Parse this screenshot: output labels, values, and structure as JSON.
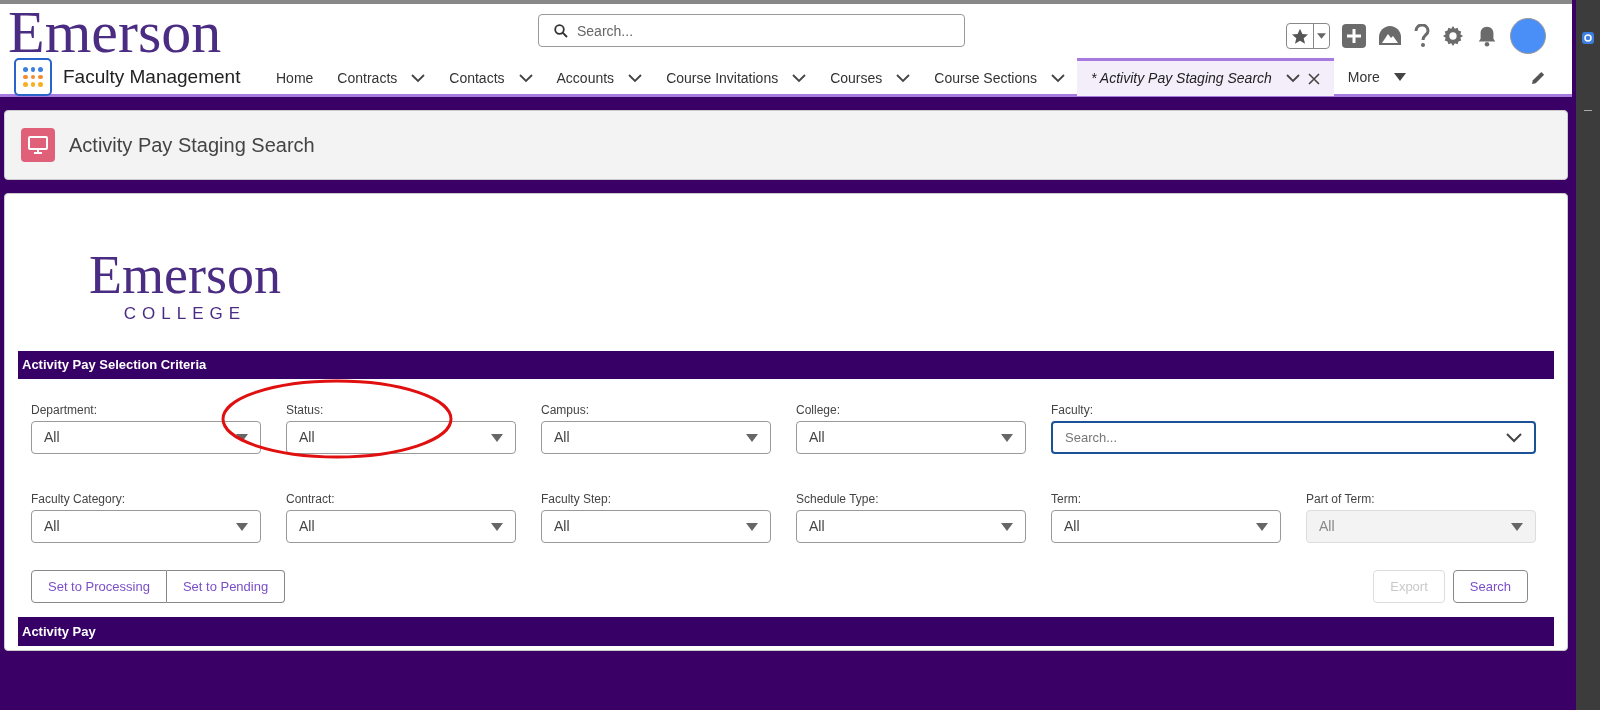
{
  "header": {
    "logo": "Emerson",
    "search": {
      "placeholder": "Search..."
    }
  },
  "nav": {
    "app_name": "Faculty Management",
    "tabs": [
      {
        "label": "Home",
        "dropdown": false,
        "selected": false,
        "closable": false
      },
      {
        "label": "Contracts",
        "dropdown": true,
        "selected": false,
        "closable": false
      },
      {
        "label": "Contacts",
        "dropdown": true,
        "selected": false,
        "closable": false
      },
      {
        "label": "Accounts",
        "dropdown": true,
        "selected": false,
        "closable": false
      },
      {
        "label": "Course Invitations",
        "dropdown": true,
        "selected": false,
        "closable": false
      },
      {
        "label": "Courses",
        "dropdown": true,
        "selected": false,
        "closable": false
      },
      {
        "label": "Course Sections",
        "dropdown": true,
        "selected": false,
        "closable": false
      },
      {
        "label": "* Activity Pay Staging Search",
        "dropdown": true,
        "selected": true,
        "closable": true
      }
    ],
    "more": "More"
  },
  "page_header": {
    "title": "Activity Pay Staging Search"
  },
  "card": {
    "logo_name": "Emerson",
    "logo_sub": "COLLEGE",
    "criteria_title": "Activity Pay Selection Criteria",
    "fields": [
      {
        "label": "Department:",
        "kind": "select",
        "value": "All",
        "disabled": false
      },
      {
        "label": "Status:",
        "kind": "select",
        "value": "All",
        "disabled": false
      },
      {
        "label": "Campus:",
        "kind": "select",
        "value": "All",
        "disabled": false
      },
      {
        "label": "College:",
        "kind": "select",
        "value": "All",
        "disabled": false
      },
      {
        "label": "Faculty:",
        "kind": "combobox",
        "placeholder": "Search...",
        "disabled": false,
        "focused": true
      },
      {
        "label": "Faculty Category:",
        "kind": "select",
        "value": "All",
        "disabled": false
      },
      {
        "label": "Contract:",
        "kind": "select",
        "value": "All",
        "disabled": false
      },
      {
        "label": "Faculty Step:",
        "kind": "select",
        "value": "All",
        "disabled": false
      },
      {
        "label": "Schedule Type:",
        "kind": "select",
        "value": "All",
        "disabled": false
      },
      {
        "label": "Term:",
        "kind": "select",
        "value": "All",
        "disabled": false
      },
      {
        "label": "Part of Term:",
        "kind": "select",
        "value": "All",
        "disabled": true
      }
    ],
    "left_buttons": [
      {
        "label": "Set to Processing",
        "disabled": false
      },
      {
        "label": "Set to Pending",
        "disabled": false
      }
    ],
    "right_buttons": [
      {
        "label": "Export",
        "disabled": true
      },
      {
        "label": "Search",
        "disabled": false
      }
    ],
    "results_title": "Activity Pay"
  }
}
